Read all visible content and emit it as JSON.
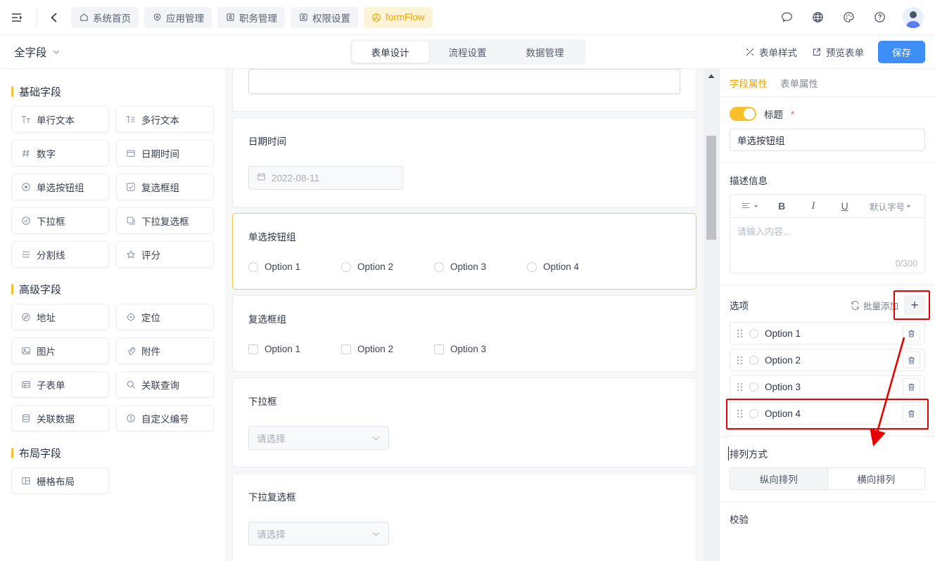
{
  "header": {
    "collapse_icon": "sidebar-collapse-icon",
    "back_icon": "chevron-left-icon",
    "nav_tabs": [
      {
        "label": "系统首页",
        "icon": "home-icon",
        "active": false
      },
      {
        "label": "应用管理",
        "icon": "apps-icon",
        "active": false
      },
      {
        "label": "职务管理",
        "icon": "id-card-icon",
        "active": false
      },
      {
        "label": "权限设置",
        "icon": "id-card-icon",
        "active": false
      },
      {
        "label": "formFlow",
        "icon": "flow-icon",
        "active": true
      }
    ],
    "right_icons": [
      "message-icon",
      "globe-icon",
      "palette-icon",
      "help-icon",
      "avatar"
    ]
  },
  "subheader": {
    "form_name": "全字段",
    "tabs": [
      {
        "label": "表单设计",
        "active": true
      },
      {
        "label": "流程设置",
        "active": false
      },
      {
        "label": "数据管理",
        "active": false
      }
    ],
    "style_button": "表单样式",
    "preview_button": "预览表单",
    "save_button": "保存"
  },
  "palette": {
    "groups": [
      {
        "title": "基础字段",
        "fields": [
          {
            "label": "单行文本",
            "icon": "text-icon"
          },
          {
            "label": "多行文本",
            "icon": "textarea-icon"
          },
          {
            "label": "数字",
            "icon": "number-icon"
          },
          {
            "label": "日期时间",
            "icon": "calendar-icon"
          },
          {
            "label": "单选按钮组",
            "icon": "radio-icon"
          },
          {
            "label": "复选框组",
            "icon": "checkbox-icon"
          },
          {
            "label": "下拉框",
            "icon": "select-icon"
          },
          {
            "label": "下拉复选框",
            "icon": "multiselect-icon"
          },
          {
            "label": "分割线",
            "icon": "divider-icon"
          },
          {
            "label": "评分",
            "icon": "star-icon"
          }
        ]
      },
      {
        "title": "高级字段",
        "fields": [
          {
            "label": "地址",
            "icon": "address-icon"
          },
          {
            "label": "定位",
            "icon": "location-icon"
          },
          {
            "label": "图片",
            "icon": "image-icon"
          },
          {
            "label": "附件",
            "icon": "paperclip-icon"
          },
          {
            "label": "子表单",
            "icon": "subform-icon"
          },
          {
            "label": "关联查询",
            "icon": "search-icon"
          },
          {
            "label": "关联数据",
            "icon": "database-icon"
          },
          {
            "label": "自定义编号",
            "icon": "number-circle-icon"
          }
        ]
      },
      {
        "title": "布局字段",
        "fields": [
          {
            "label": "栅格布局",
            "icon": "grid-layout-icon"
          }
        ]
      }
    ]
  },
  "canvas": {
    "cards": [
      {
        "type": "textarea",
        "label": "",
        "selected": false
      },
      {
        "type": "date",
        "label": "日期时间",
        "value": "2022-08-11",
        "selected": false
      },
      {
        "type": "radio",
        "label": "单选按钮组",
        "selected": true,
        "options": [
          "Option 1",
          "Option 2",
          "Option 3",
          "Option 4"
        ]
      },
      {
        "type": "checkbox",
        "label": "复选框组",
        "selected": false,
        "options": [
          "Option 1",
          "Option 2",
          "Option 3"
        ]
      },
      {
        "type": "select",
        "label": "下拉框",
        "placeholder": "请选择",
        "selected": false
      },
      {
        "type": "multiselect",
        "label": "下拉复选框",
        "placeholder": "请选择",
        "selected": false
      }
    ]
  },
  "props": {
    "tabs": [
      {
        "label": "字段属性",
        "active": true
      },
      {
        "label": "表单属性",
        "active": false
      }
    ],
    "title_section": {
      "toggle_on": true,
      "label": "标题",
      "required_mark": "*",
      "value": "单选按钮组"
    },
    "desc_section": {
      "label": "描述信息",
      "toolbar": {
        "align": "align-icon",
        "bold": "B",
        "italic": "I",
        "underline": "U",
        "font_size": "默认字号"
      },
      "placeholder": "请输入内容...",
      "counter": "0/300"
    },
    "options_section": {
      "label": "选项",
      "batch_add": "批量添加",
      "add_button": "+",
      "items": [
        {
          "label": "Option 1",
          "highlighted": false
        },
        {
          "label": "Option 2",
          "highlighted": false
        },
        {
          "label": "Option 3",
          "highlighted": false
        },
        {
          "label": "Option 4",
          "highlighted": true
        }
      ]
    },
    "layout_section": {
      "label": "排列方式",
      "options": [
        {
          "label": "纵向排列",
          "selected": true
        },
        {
          "label": "横向排列",
          "selected": false
        }
      ]
    },
    "validation_section": {
      "label": "校验"
    }
  },
  "annotation": {
    "highlight_color": "#e60000",
    "arrow_from": "add-option-button",
    "arrow_to": "option-4-row"
  },
  "colors": {
    "accent_yellow": "#f0a500",
    "primary_blue": "#3e8ef7",
    "canvas_bg": "#f6f7f9",
    "annotation_red": "#e60000"
  }
}
